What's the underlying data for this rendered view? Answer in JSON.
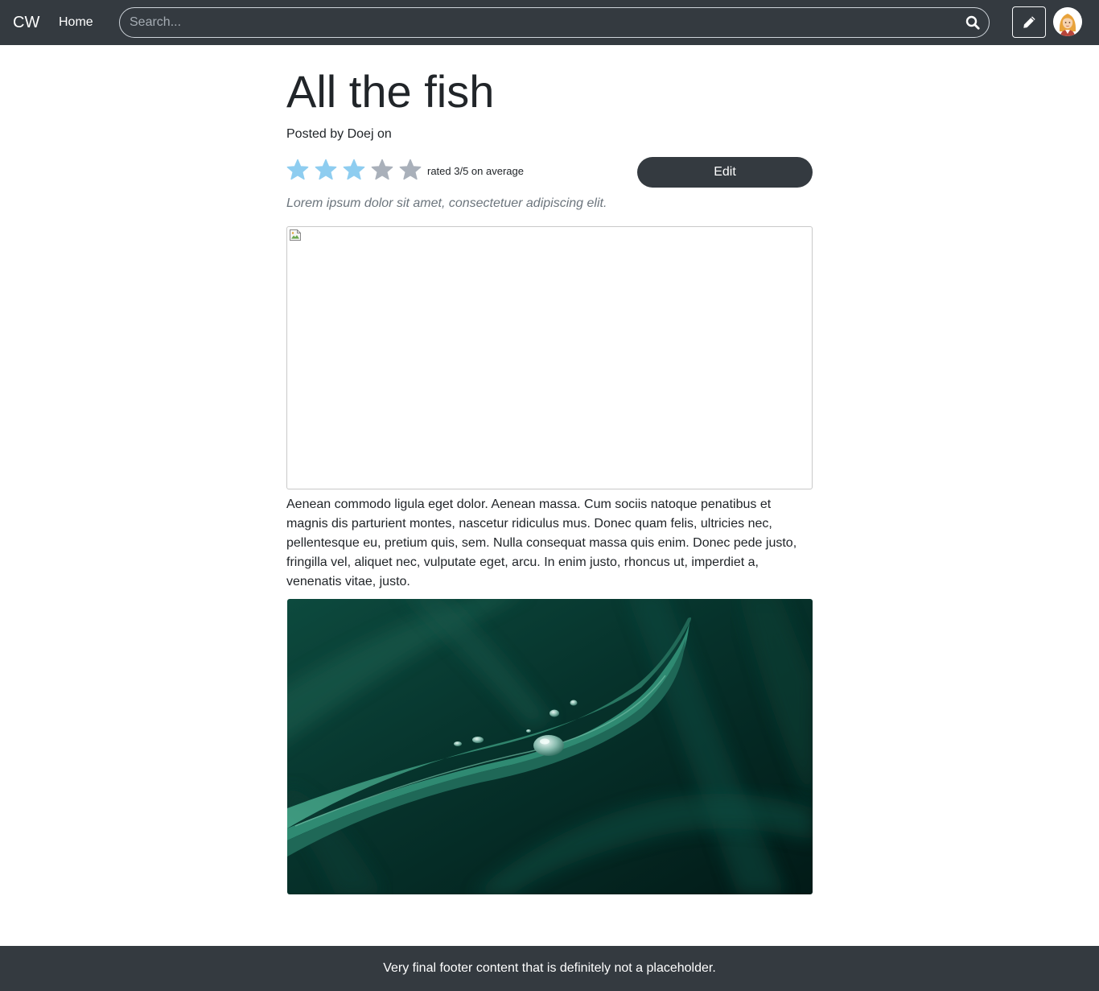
{
  "navbar": {
    "brand": "CW",
    "home_label": "Home",
    "search_placeholder": "Search...",
    "search_icon": "search-icon",
    "write_icon": "pencil-icon",
    "avatar_icon": "avatar-icon"
  },
  "post": {
    "title": "All the fish",
    "byline": "Posted by Doej on",
    "rating": {
      "value": 3,
      "max": 5,
      "text": "rated 3/5 on average",
      "filled_color": "#8ecdf0",
      "empty_color": "#a9b0ba"
    },
    "edit_label": "Edit",
    "subtitle": "Lorem ipsum dolor sit amet, consectetuer adipiscing elit.",
    "body": "Aenean commodo ligula eget dolor. Aenean massa. Cum sociis natoque penatibus et magnis dis parturient montes, nascetur ridiculus mus. Donec quam felis, ultricies nec, pellentesque eu, pretium quis, sem. Nulla consequat massa quis enim. Donec pede justo, fringilla vel, aliquet nec, vulputate eget, arcu. In enim justo, rhoncus ut, imperdiet a, venenatis vitae, justo."
  },
  "footer": {
    "text": "Very final footer content that is definitely not a placeholder."
  },
  "colors": {
    "navbar_bg": "#343a40",
    "leaf": "#2f8a72",
    "photo_dark": "#04211c"
  }
}
